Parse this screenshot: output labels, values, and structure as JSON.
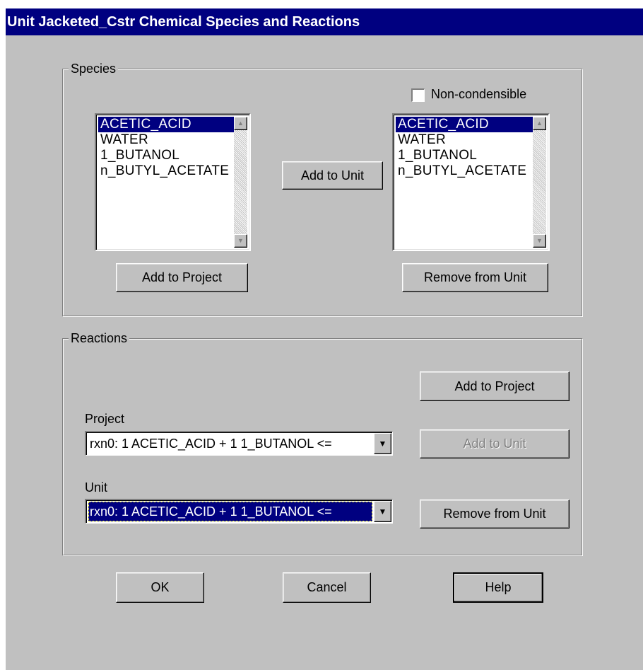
{
  "window": {
    "title": "Unit Jacketed_Cstr Chemical Species and Reactions"
  },
  "species": {
    "group_label": "Species",
    "non_condensible_label": "Non-condensible",
    "non_condensible_checked": false,
    "project_list": {
      "items": [
        "ACETIC_ACID",
        "WATER",
        "1_BUTANOL",
        "n_BUTYL_ACETATE"
      ],
      "selected_index": 0
    },
    "unit_list": {
      "items": [
        "ACETIC_ACID",
        "WATER",
        "1_BUTANOL",
        "n_BUTYL_ACETATE"
      ],
      "selected_index": 0
    },
    "add_to_unit_label": "Add to Unit",
    "add_to_project_label": "Add to Project",
    "remove_from_unit_label": "Remove from Unit"
  },
  "reactions": {
    "group_label": "Reactions",
    "add_to_project_label": "Add to Project",
    "project_label": "Project",
    "project_value": "rxn0: 1 ACETIC_ACID + 1 1_BUTANOL <=",
    "add_to_unit_label": "Add to Unit",
    "unit_label": "Unit",
    "unit_value": "rxn0: 1 ACETIC_ACID + 1 1_BUTANOL <=",
    "remove_from_unit_label": "Remove from Unit"
  },
  "footer": {
    "ok_label": "OK",
    "cancel_label": "Cancel",
    "help_label": "Help"
  },
  "icons": {
    "scroll_up": "scroll-up-arrow-icon",
    "scroll_down": "scroll-down-arrow-icon",
    "dropdown": "dropdown-arrow-icon"
  },
  "colors": {
    "title_bar": "#000080",
    "dialog_bg": "#c0c0c0",
    "selection": "#000080"
  }
}
